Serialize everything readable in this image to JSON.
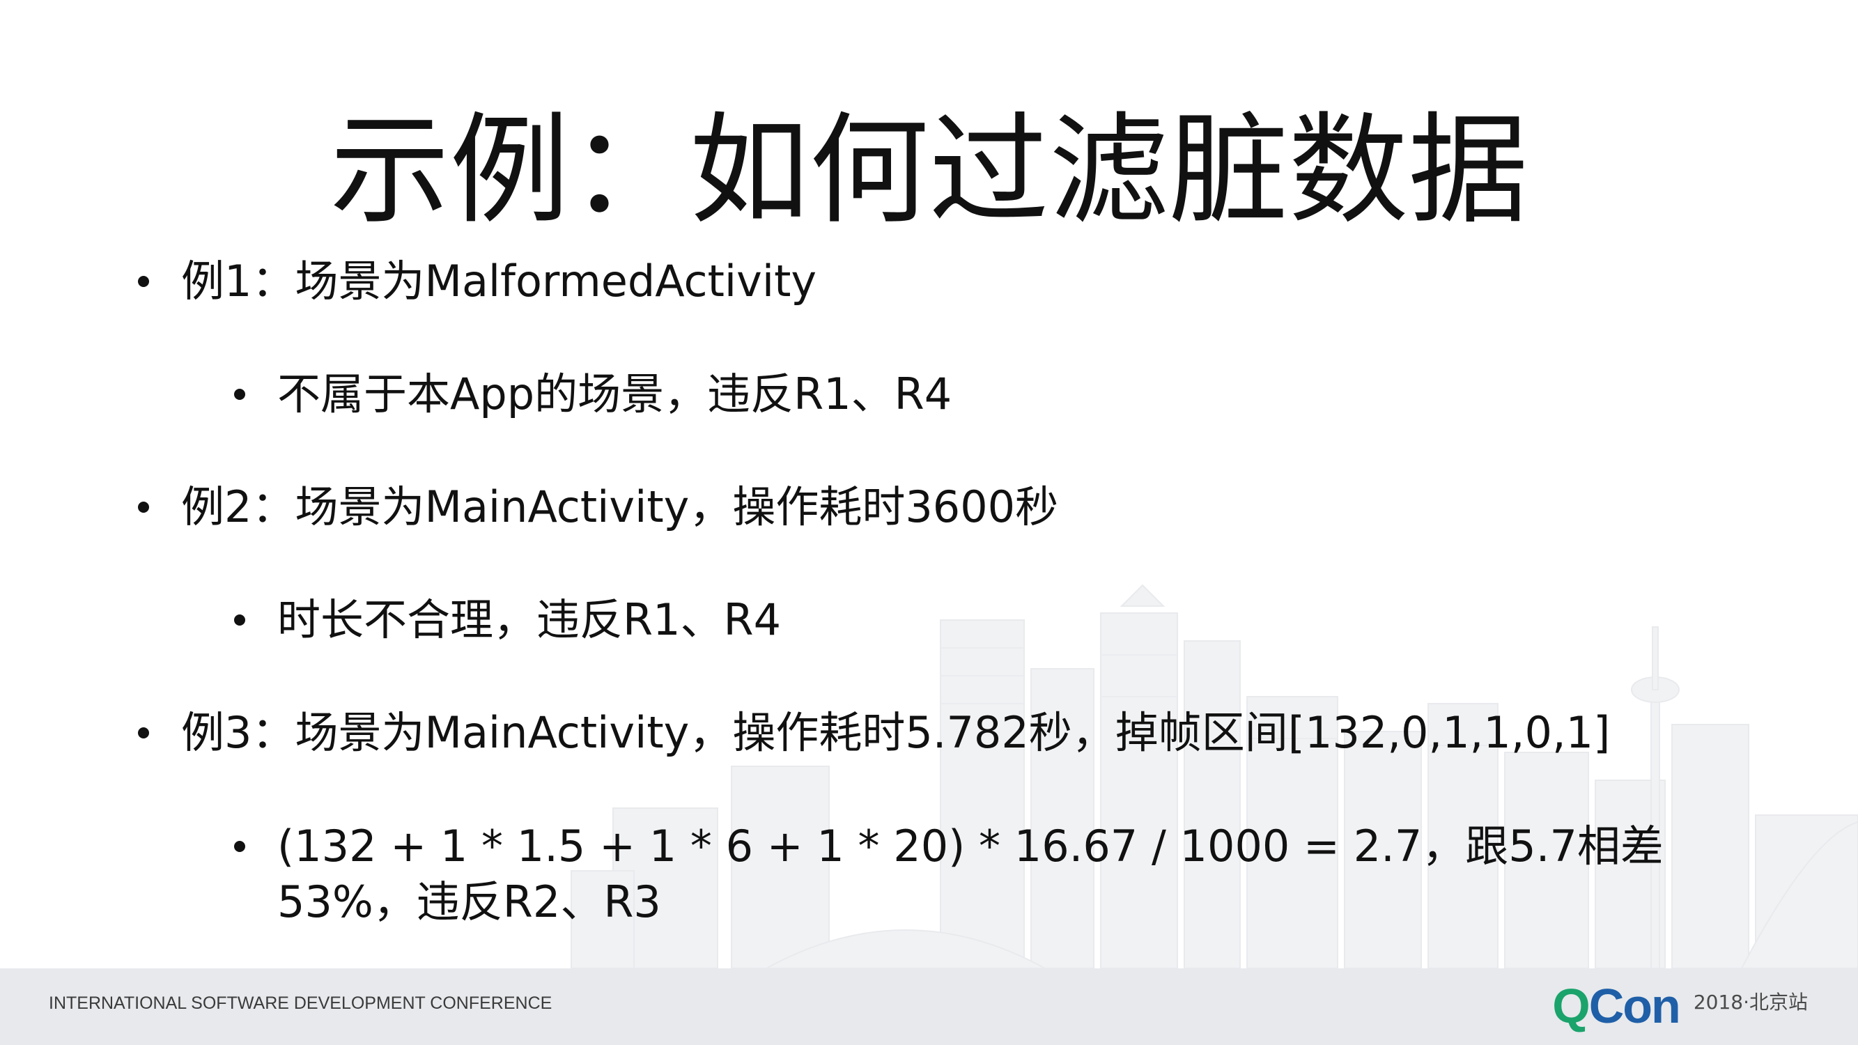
{
  "slide": {
    "title": "示例：如何过滤脏数据",
    "bullets": [
      {
        "level": 1,
        "text": "例1：场景为MalformedActivity"
      },
      {
        "level": 2,
        "text": "不属于本App的场景，违反R1、R4"
      },
      {
        "level": 1,
        "text": "例2：场景为MainActivity，操作耗时3600秒"
      },
      {
        "level": 2,
        "text": "时长不合理，违反R1、R4"
      },
      {
        "level": 1,
        "text": "例3：场景为MainActivity，操作耗时5.782秒，掉帧区间[132,0,1,1,0,1]"
      },
      {
        "level": 2,
        "text": "(132 + 1 * 1.5 + 1 * 6 + 1 * 20) * 16.67 / 1000 = 2.7，跟5.7相差53%，违反R2、R3"
      }
    ]
  },
  "footer": {
    "conference": "INTERNATIONAL SOFTWARE DEVELOPMENT CONFERENCE",
    "brand_q": "Q",
    "brand_con": "Con",
    "edition": "2018·北京站"
  },
  "colors": {
    "brand_green": "#1aa36b",
    "brand_blue": "#1f5fa8",
    "footer_bg": "#e7e9ec",
    "text": "#111111"
  }
}
